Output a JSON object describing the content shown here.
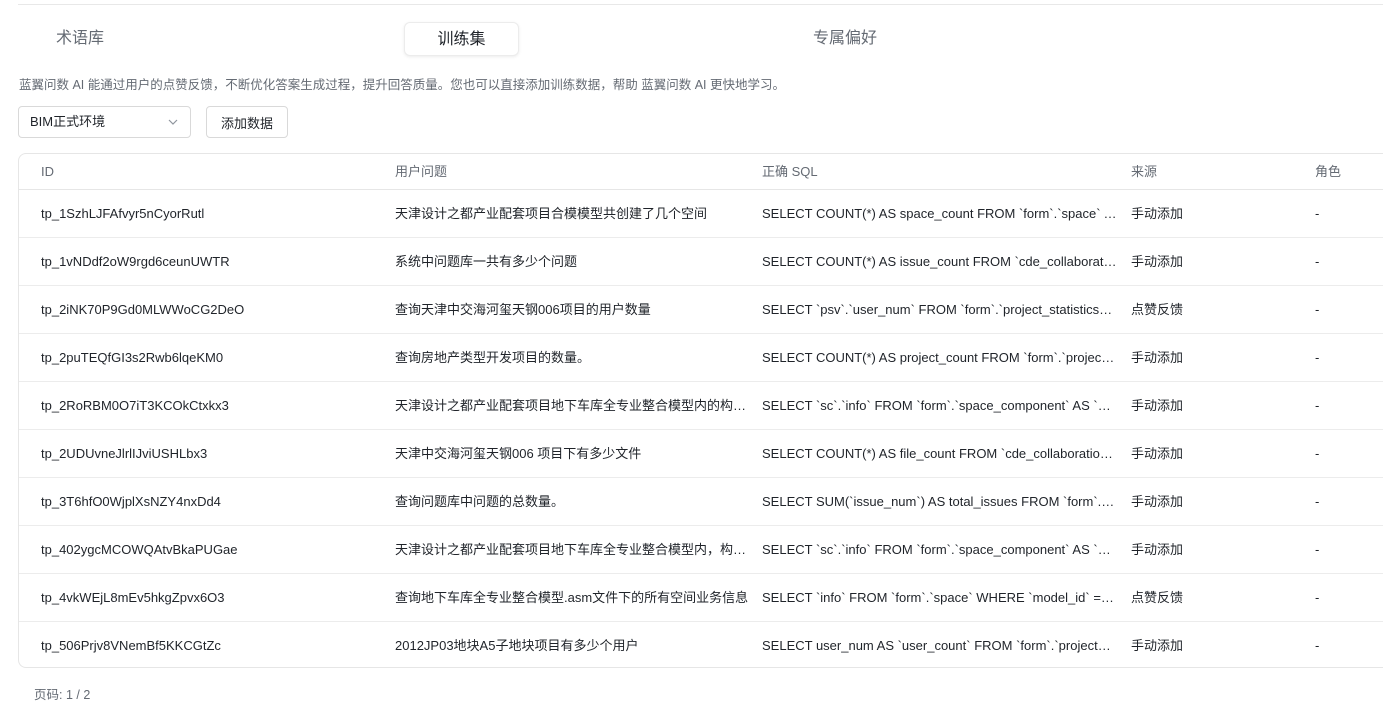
{
  "tabs": [
    {
      "label": "术语库",
      "active": false
    },
    {
      "label": "训练集",
      "active": true
    },
    {
      "label": "专属偏好",
      "active": false
    }
  ],
  "description": "蓝翼问数 AI 能通过用户的点赞反馈，不断优化答案生成过程，提升回答质量。您也可以直接添加训练数据，帮助 蓝翼问数 AI 更快地学习。",
  "environment_select": {
    "value": "BIM正式环境",
    "icon": "chevron-down-icon"
  },
  "add_button": {
    "label": "添加数据"
  },
  "table": {
    "headers": {
      "id": "ID",
      "question": "用户问题",
      "sql": "正确 SQL",
      "source": "来源",
      "role": "角色"
    },
    "rows": [
      {
        "id": "tp_1SzhLJFAfvyr5nCyorRutl",
        "question": "天津设计之都产业配套项目合模模型共创建了几个空间",
        "sql": "SELECT COUNT(*) AS space_count FROM `form`.`space` AS `s` WHERE",
        "source": "手动添加",
        "role": "-"
      },
      {
        "id": "tp_1vNDdf2oW9rgd6ceunUWTR",
        "question": "系统中问题库一共有多少个问题",
        "sql": "SELECT COUNT(*) AS issue_count FROM `cde_collaboration`.`issue`",
        "source": "手动添加",
        "role": "-"
      },
      {
        "id": "tp_2iNK70P9Gd0MLWWoCG2DeO",
        "question": "查询天津中交海河玺天钢006项目的用户数量",
        "sql": "SELECT `psv`.`user_num` FROM `form`.`project_statistics_view`",
        "source": "点赞反馈",
        "role": "-"
      },
      {
        "id": "tp_2puTEQfGI3s2Rwb6lqeKM0",
        "question": "查询房地产类型开发项目的数量。",
        "sql": "SELECT COUNT(*) AS project_count FROM `form`.`project_info`",
        "source": "手动添加",
        "role": "-"
      },
      {
        "id": "tp_2RoRBM0O7iT3KCOkCtxkx3",
        "question": "天津设计之都产业配套项目地下车库全专业整合模型内的构件有哪些",
        "sql": "SELECT `sc`.`info` FROM `form`.`space_component` AS `sc` WHERE",
        "source": "手动添加",
        "role": "-"
      },
      {
        "id": "tp_2UDUvneJlrlIJviUSHLbx3",
        "question": "天津中交海河玺天钢006 项目下有多少文件",
        "sql": "SELECT COUNT(*) AS file_count FROM `cde_collaboration`.`file`",
        "source": "手动添加",
        "role": "-"
      },
      {
        "id": "tp_3T6hfO0WjplXsNZY4nxDd4",
        "question": "查询问题库中问题的总数量。",
        "sql": "SELECT SUM(`issue_num`) AS total_issues FROM `form`.`project`",
        "source": "手动添加",
        "role": "-"
      },
      {
        "id": "tp_402ygcMCOWQAtvBkaPUGae",
        "question": "天津设计之都产业配套项目地下车库全专业整合模型内，构件的信息",
        "sql": "SELECT `sc`.`info` FROM `form`.`space_component` AS `sc` WHERE",
        "source": "手动添加",
        "role": "-"
      },
      {
        "id": "tp_4vkWEjL8mEv5hkgZpvx6O3",
        "question": "查询地下车库全专业整合模型.asm文件下的所有空间业务信息",
        "sql": "SELECT `info` FROM `form`.`space` WHERE `model_id` = (SELECT",
        "source": "点赞反馈",
        "role": "-"
      },
      {
        "id": "tp_506Prjv8VNemBf5KKCGtZc",
        "question": "2012JP03地块A5子地块项目有多少个用户",
        "sql": "SELECT user_num AS `user_count` FROM `form`.`project_statistics`",
        "source": "手动添加",
        "role": "-"
      }
    ]
  },
  "pagination": {
    "label": "页码: 1 / 2"
  }
}
